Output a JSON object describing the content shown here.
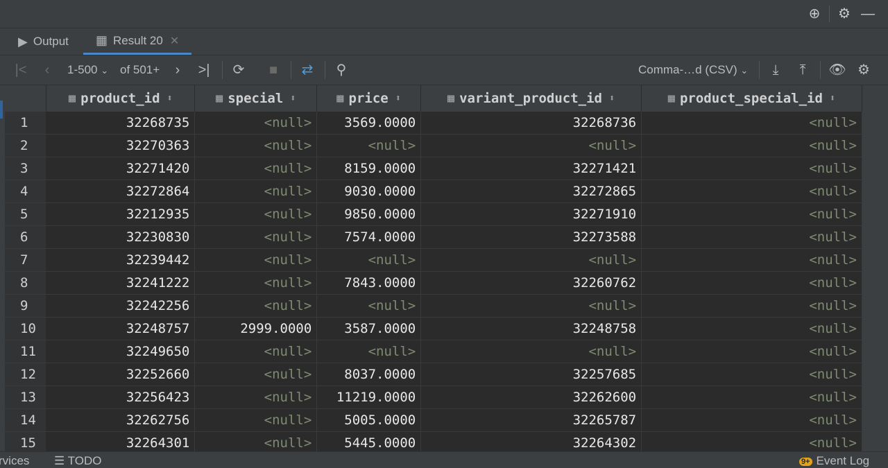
{
  "tabs": [
    {
      "label": "Output",
      "icon": "output-icon"
    },
    {
      "label": "Result 20",
      "icon": "table-icon",
      "active": true
    }
  ],
  "toolbar": {
    "page_range": "1-500",
    "page_total": "of 501+",
    "export_format": "Comma-…d (CSV)"
  },
  "columns": [
    {
      "label": "product_id"
    },
    {
      "label": "special"
    },
    {
      "label": "price"
    },
    {
      "label": "variant_product_id"
    },
    {
      "label": "product_special_id"
    }
  ],
  "rows": [
    {
      "n": "1",
      "cells": [
        "32268735",
        "<null>",
        "3569.0000",
        "32268736",
        "<null>"
      ]
    },
    {
      "n": "2",
      "cells": [
        "32270363",
        "<null>",
        "<null>",
        "<null>",
        "<null>"
      ]
    },
    {
      "n": "3",
      "cells": [
        "32271420",
        "<null>",
        "8159.0000",
        "32271421",
        "<null>"
      ]
    },
    {
      "n": "4",
      "cells": [
        "32272864",
        "<null>",
        "9030.0000",
        "32272865",
        "<null>"
      ]
    },
    {
      "n": "5",
      "cells": [
        "32212935",
        "<null>",
        "9850.0000",
        "32271910",
        "<null>"
      ]
    },
    {
      "n": "6",
      "cells": [
        "32230830",
        "<null>",
        "7574.0000",
        "32273588",
        "<null>"
      ]
    },
    {
      "n": "7",
      "cells": [
        "32239442",
        "<null>",
        "<null>",
        "<null>",
        "<null>"
      ]
    },
    {
      "n": "8",
      "cells": [
        "32241222",
        "<null>",
        "7843.0000",
        "32260762",
        "<null>"
      ]
    },
    {
      "n": "9",
      "cells": [
        "32242256",
        "<null>",
        "<null>",
        "<null>",
        "<null>"
      ]
    },
    {
      "n": "10",
      "cells": [
        "32248757",
        "2999.0000",
        "3587.0000",
        "32248758",
        "<null>"
      ]
    },
    {
      "n": "11",
      "cells": [
        "32249650",
        "<null>",
        "<null>",
        "<null>",
        "<null>"
      ]
    },
    {
      "n": "12",
      "cells": [
        "32252660",
        "<null>",
        "8037.0000",
        "32257685",
        "<null>"
      ]
    },
    {
      "n": "13",
      "cells": [
        "32256423",
        "<null>",
        "11219.0000",
        "32262600",
        "<null>"
      ]
    },
    {
      "n": "14",
      "cells": [
        "32262756",
        "<null>",
        "5005.0000",
        "32265787",
        "<null>"
      ]
    },
    {
      "n": "15",
      "cells": [
        "32264301",
        "<null>",
        "5445.0000",
        "32264302",
        "<null>"
      ]
    }
  ],
  "statusbar": {
    "services_label": "rvices",
    "todo_label": "TODO",
    "event_log_label": "Event Log",
    "event_badge": "9+"
  },
  "colors": {
    "background": "#3c3f41",
    "grid": "#2b2b2b",
    "null_text": "#7f8a72",
    "accent": "#4a88c7"
  }
}
